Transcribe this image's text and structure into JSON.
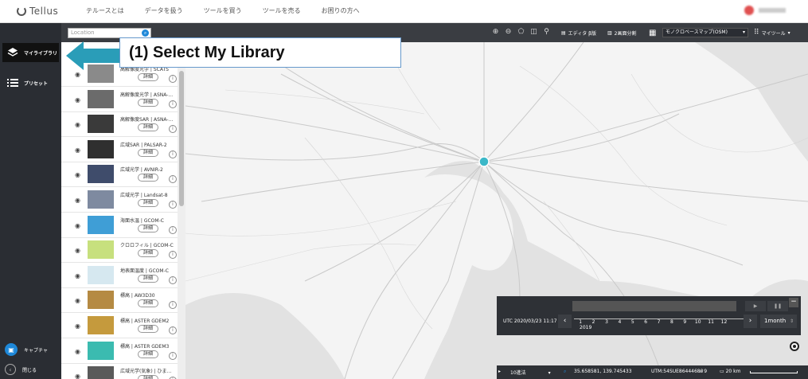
{
  "topnav": {
    "logo": "Tellus",
    "links": [
      "テルースとは",
      "データを扱う",
      "ツールを買う",
      "ツールを売る",
      "お困りの方へ"
    ]
  },
  "sidebar": {
    "items": [
      {
        "label": "マイライブラリ",
        "icon": "layers-icon"
      },
      {
        "label": "プリセット",
        "icon": "list-icon"
      }
    ],
    "capture_label": "キャプチャ",
    "close_label": "閉じる"
  },
  "toolbar": {
    "location_placeholder": "Location",
    "editor_label": "エディタ β版",
    "split_label": "2画面分割",
    "basemap": "モノクロベースマップ(OSM)",
    "mytools_label": "マイツール"
  },
  "callout": {
    "text": "(1) Select My Library"
  },
  "library": {
    "detail_label": "詳細",
    "items": [
      {
        "name": "高解像度光学 | SCATS",
        "thumb": "#8a8a8a"
      },
      {
        "name": "高解像度光学 | ASNA-...",
        "thumb": "#6b6b6b"
      },
      {
        "name": "高解像度SAR | ASNA-...",
        "thumb": "#3a3a3a"
      },
      {
        "name": "広域SAR | PALSAR-2",
        "thumb": "#2f2f2f"
      },
      {
        "name": "広域光学 | AVNIR-2",
        "thumb": "#3f4c6b"
      },
      {
        "name": "広域光学 | Landsat-8",
        "thumb": "#7e8aa0"
      },
      {
        "name": "海面水温 | GCOM-C",
        "thumb": "#3f9ed6"
      },
      {
        "name": "クロロフィル | GCOM-C",
        "thumb": "#c7e07e"
      },
      {
        "name": "地表面温度 | GCOM-C",
        "thumb": "#d6e8f0"
      },
      {
        "name": "標高 | AW3D30",
        "thumb": "#b58a43"
      },
      {
        "name": "標高 | ASTER GDEM2",
        "thumb": "#c59a3d"
      },
      {
        "name": "標高 | ASTER GDEM3",
        "thumb": "#3bbbb0"
      },
      {
        "name": "広域光学(気象) | ひま...",
        "thumb": "#5a5a5a"
      }
    ]
  },
  "timeline": {
    "utc_label": "UTC",
    "datetime": "2020/03/23 11:17",
    "months": [
      "1",
      "2",
      "3",
      "4",
      "5",
      "6",
      "7",
      "8",
      "9",
      "10",
      "11",
      "12"
    ],
    "year": "2019",
    "range": "1month"
  },
  "statusbar": {
    "projection": "10進法",
    "coords": "35.658581, 139.745433",
    "utm": "UTM:54SUE86444680",
    "zoom": "9",
    "scale": "20 km"
  },
  "colors": {
    "accent": "#1e88d9",
    "sidebar_bg": "#2a2d33",
    "callout_arrow": "#2a9db8",
    "map_marker": "#3cb8c8"
  }
}
